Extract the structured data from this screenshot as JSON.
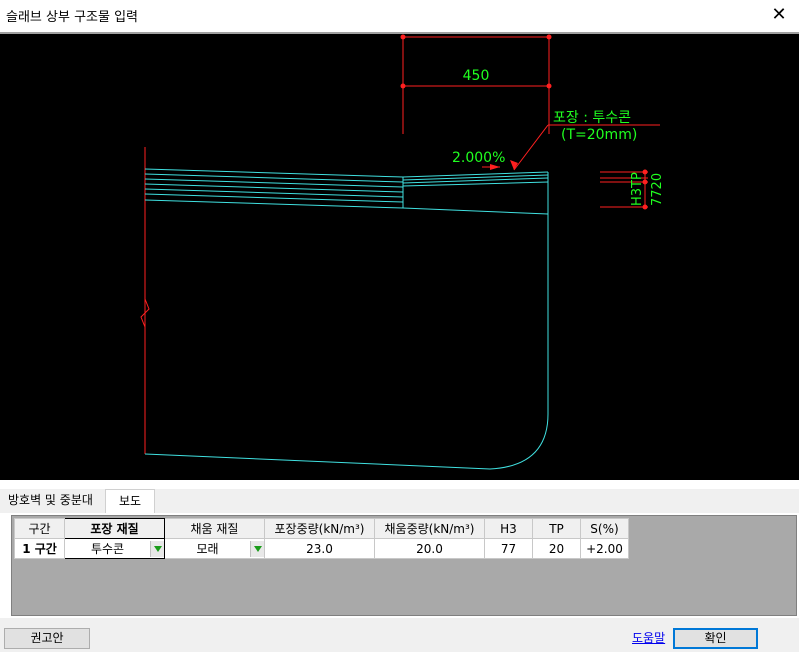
{
  "window": {
    "title": "슬래브 상부 구조물 입력",
    "close_glyph": "✕"
  },
  "drawing": {
    "dim_width": "450",
    "pavement_label": "포장 : 투수콘",
    "thickness_label": "(T=20mm)",
    "slope_label": "2.000%",
    "h3_label": "H3",
    "tp_label": "TP",
    "h3_value": "77",
    "tp_value": "20",
    "colors": {
      "background": "#000000",
      "structure": "#40e0e0",
      "dimension": "#ff2020",
      "text": "#20ff20"
    }
  },
  "tabs": [
    {
      "label": "방호벽 및 중분대",
      "active": false
    },
    {
      "label": "보도",
      "active": true
    }
  ],
  "grid": {
    "headers": [
      "구간",
      "포장 재질",
      "채움 재질",
      "포장중량(kN/m³)",
      "채움중량(kN/m³)",
      "H3",
      "TP",
      "S(%)"
    ],
    "rows": [
      {
        "section": "1 구간",
        "pavement_material": "투수콘",
        "fill_material": "모래",
        "pavement_weight": "23.0",
        "fill_weight": "20.0",
        "h3": "77",
        "tp": "20",
        "slope": "+2.00"
      }
    ]
  },
  "footer": {
    "recommend_label": "권고안",
    "help_label": "도움말",
    "ok_label": "확인"
  }
}
